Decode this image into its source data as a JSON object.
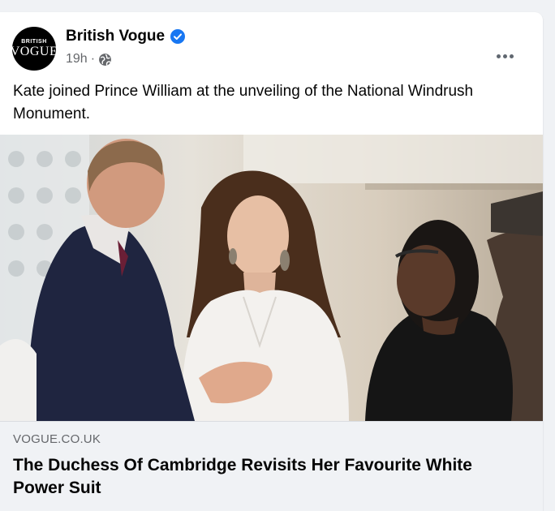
{
  "post": {
    "page_name": "British Vogue",
    "avatar_line1": "BRITISH",
    "avatar_line2": "VOGUE",
    "timestamp": "19h",
    "separator": "·",
    "privacy_icon": "globe-icon",
    "verified_icon": "verified-badge-icon",
    "more_icon": "more-options-icon",
    "text": "Kate joined Prince William at the unveiling of the National Windrush Monument."
  },
  "link_preview": {
    "domain": "VOGUE.CO.UK",
    "title": "The Duchess Of Cambridge Revisits Her Favourite White Power Suit"
  },
  "colors": {
    "background": "#f0f2f5",
    "card": "#ffffff",
    "verified": "#1877f2",
    "secondary_text": "#65676b",
    "primary_text": "#050505"
  }
}
